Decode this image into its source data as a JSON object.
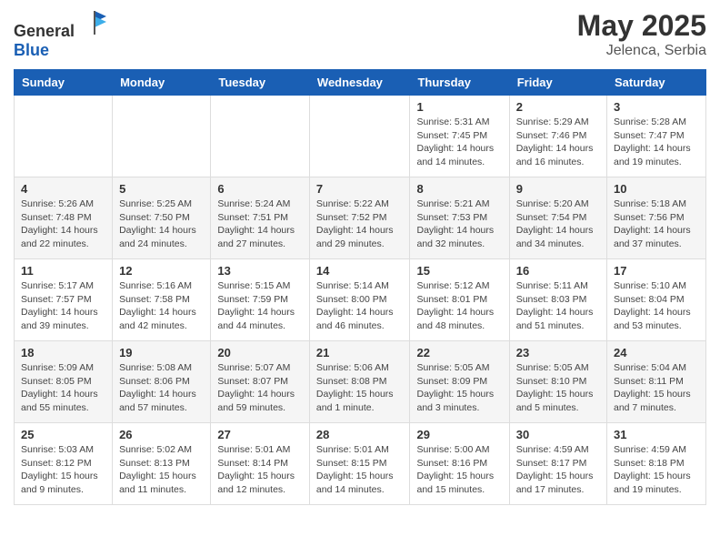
{
  "header": {
    "logo_general": "General",
    "logo_blue": "Blue",
    "title": "May 2025",
    "location": "Jelenca, Serbia"
  },
  "weekdays": [
    "Sunday",
    "Monday",
    "Tuesday",
    "Wednesday",
    "Thursday",
    "Friday",
    "Saturday"
  ],
  "weeks": [
    [
      {
        "day": "",
        "info": ""
      },
      {
        "day": "",
        "info": ""
      },
      {
        "day": "",
        "info": ""
      },
      {
        "day": "",
        "info": ""
      },
      {
        "day": "1",
        "info": "Sunrise: 5:31 AM\nSunset: 7:45 PM\nDaylight: 14 hours\nand 14 minutes."
      },
      {
        "day": "2",
        "info": "Sunrise: 5:29 AM\nSunset: 7:46 PM\nDaylight: 14 hours\nand 16 minutes."
      },
      {
        "day": "3",
        "info": "Sunrise: 5:28 AM\nSunset: 7:47 PM\nDaylight: 14 hours\nand 19 minutes."
      }
    ],
    [
      {
        "day": "4",
        "info": "Sunrise: 5:26 AM\nSunset: 7:48 PM\nDaylight: 14 hours\nand 22 minutes."
      },
      {
        "day": "5",
        "info": "Sunrise: 5:25 AM\nSunset: 7:50 PM\nDaylight: 14 hours\nand 24 minutes."
      },
      {
        "day": "6",
        "info": "Sunrise: 5:24 AM\nSunset: 7:51 PM\nDaylight: 14 hours\nand 27 minutes."
      },
      {
        "day": "7",
        "info": "Sunrise: 5:22 AM\nSunset: 7:52 PM\nDaylight: 14 hours\nand 29 minutes."
      },
      {
        "day": "8",
        "info": "Sunrise: 5:21 AM\nSunset: 7:53 PM\nDaylight: 14 hours\nand 32 minutes."
      },
      {
        "day": "9",
        "info": "Sunrise: 5:20 AM\nSunset: 7:54 PM\nDaylight: 14 hours\nand 34 minutes."
      },
      {
        "day": "10",
        "info": "Sunrise: 5:18 AM\nSunset: 7:56 PM\nDaylight: 14 hours\nand 37 minutes."
      }
    ],
    [
      {
        "day": "11",
        "info": "Sunrise: 5:17 AM\nSunset: 7:57 PM\nDaylight: 14 hours\nand 39 minutes."
      },
      {
        "day": "12",
        "info": "Sunrise: 5:16 AM\nSunset: 7:58 PM\nDaylight: 14 hours\nand 42 minutes."
      },
      {
        "day": "13",
        "info": "Sunrise: 5:15 AM\nSunset: 7:59 PM\nDaylight: 14 hours\nand 44 minutes."
      },
      {
        "day": "14",
        "info": "Sunrise: 5:14 AM\nSunset: 8:00 PM\nDaylight: 14 hours\nand 46 minutes."
      },
      {
        "day": "15",
        "info": "Sunrise: 5:12 AM\nSunset: 8:01 PM\nDaylight: 14 hours\nand 48 minutes."
      },
      {
        "day": "16",
        "info": "Sunrise: 5:11 AM\nSunset: 8:03 PM\nDaylight: 14 hours\nand 51 minutes."
      },
      {
        "day": "17",
        "info": "Sunrise: 5:10 AM\nSunset: 8:04 PM\nDaylight: 14 hours\nand 53 minutes."
      }
    ],
    [
      {
        "day": "18",
        "info": "Sunrise: 5:09 AM\nSunset: 8:05 PM\nDaylight: 14 hours\nand 55 minutes."
      },
      {
        "day": "19",
        "info": "Sunrise: 5:08 AM\nSunset: 8:06 PM\nDaylight: 14 hours\nand 57 minutes."
      },
      {
        "day": "20",
        "info": "Sunrise: 5:07 AM\nSunset: 8:07 PM\nDaylight: 14 hours\nand 59 minutes."
      },
      {
        "day": "21",
        "info": "Sunrise: 5:06 AM\nSunset: 8:08 PM\nDaylight: 15 hours\nand 1 minute."
      },
      {
        "day": "22",
        "info": "Sunrise: 5:05 AM\nSunset: 8:09 PM\nDaylight: 15 hours\nand 3 minutes."
      },
      {
        "day": "23",
        "info": "Sunrise: 5:05 AM\nSunset: 8:10 PM\nDaylight: 15 hours\nand 5 minutes."
      },
      {
        "day": "24",
        "info": "Sunrise: 5:04 AM\nSunset: 8:11 PM\nDaylight: 15 hours\nand 7 minutes."
      }
    ],
    [
      {
        "day": "25",
        "info": "Sunrise: 5:03 AM\nSunset: 8:12 PM\nDaylight: 15 hours\nand 9 minutes."
      },
      {
        "day": "26",
        "info": "Sunrise: 5:02 AM\nSunset: 8:13 PM\nDaylight: 15 hours\nand 11 minutes."
      },
      {
        "day": "27",
        "info": "Sunrise: 5:01 AM\nSunset: 8:14 PM\nDaylight: 15 hours\nand 12 minutes."
      },
      {
        "day": "28",
        "info": "Sunrise: 5:01 AM\nSunset: 8:15 PM\nDaylight: 15 hours\nand 14 minutes."
      },
      {
        "day": "29",
        "info": "Sunrise: 5:00 AM\nSunset: 8:16 PM\nDaylight: 15 hours\nand 15 minutes."
      },
      {
        "day": "30",
        "info": "Sunrise: 4:59 AM\nSunset: 8:17 PM\nDaylight: 15 hours\nand 17 minutes."
      },
      {
        "day": "31",
        "info": "Sunrise: 4:59 AM\nSunset: 8:18 PM\nDaylight: 15 hours\nand 19 minutes."
      }
    ]
  ]
}
